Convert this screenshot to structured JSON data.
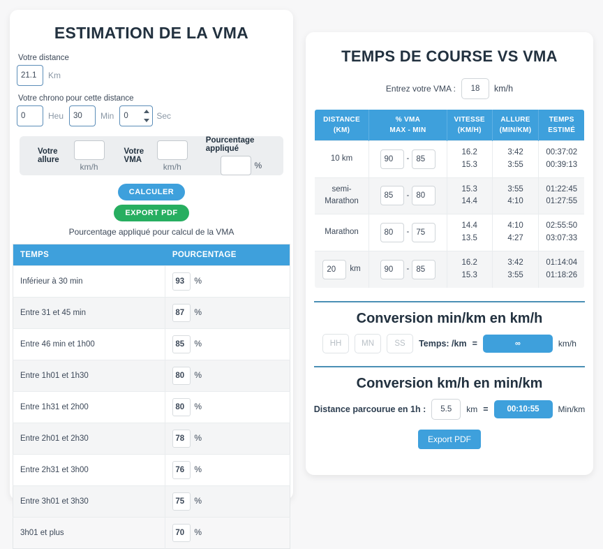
{
  "left_panel": {
    "title": "ESTIMATION DE LA VMA",
    "distance": {
      "label": "Votre distance",
      "value": "21.1",
      "unit": "Km"
    },
    "chrono": {
      "label": "Votre chrono pour cette distance",
      "hours_value": "0",
      "hours_unit": "Heu",
      "minutes_value": "30",
      "minutes_unit": "Min",
      "seconds_value": "0",
      "seconds_unit": "Sec"
    },
    "results": {
      "allure_label": "Votre allure",
      "allure_value": "",
      "allure_unit": "km/h",
      "vma_label": "Votre VMA",
      "vma_value": "",
      "vma_unit": "km/h",
      "pourcentage_label": "Pourcentage appliqué",
      "pourcentage_value": "",
      "pourcentage_unit": "%"
    },
    "buttons": {
      "calculer": "CALCULER",
      "export_pdf": "EXPORT PDF"
    },
    "table_caption": "Pourcentage appliqué pour calcul de la VMA",
    "table": {
      "headers": [
        "TEMPS",
        "POURCENTAGE"
      ],
      "rows": [
        {
          "temps": "Inférieur à 30 min",
          "pourcentage": "93",
          "unit": "%"
        },
        {
          "temps": "Entre 31 et 45 min",
          "pourcentage": "87",
          "unit": "%"
        },
        {
          "temps": "Entre 46 min et 1h00",
          "pourcentage": "85",
          "unit": "%"
        },
        {
          "temps": "Entre 1h01 et 1h30",
          "pourcentage": "80",
          "unit": "%"
        },
        {
          "temps": "Entre 1h31 et 2h00",
          "pourcentage": "80",
          "unit": "%"
        },
        {
          "temps": "Entre 2h01 et 2h30",
          "pourcentage": "78",
          "unit": "%"
        },
        {
          "temps": "Entre 2h31 et 3h00",
          "pourcentage": "76",
          "unit": "%"
        },
        {
          "temps": "Entre 3h01 et 3h30",
          "pourcentage": "75",
          "unit": "%"
        },
        {
          "temps": "3h01 et plus",
          "pourcentage": "70",
          "unit": "%"
        }
      ]
    }
  },
  "right_panel": {
    "title": "TEMPS DE COURSE VS VMA",
    "vma_entry": {
      "label": "Entrez votre VMA :",
      "value": "18",
      "unit": "km/h"
    },
    "table": {
      "headers": [
        {
          "line1": "DISTANCE",
          "line2": "(KM)"
        },
        {
          "line1": "% VMA",
          "line2": "MAX - MIN"
        },
        {
          "line1": "VITESSE",
          "line2": "(KM/H)"
        },
        {
          "line1": "ALLURE",
          "line2": "(MIN/KM)"
        },
        {
          "line1": "TEMPS",
          "line2": "ESTIMÉ"
        }
      ],
      "rows": [
        {
          "distance_label": "10 km",
          "distance_editable": false,
          "distance_value": "",
          "distance_unit": "",
          "vma_max": "90",
          "dash": "-",
          "vma_min": "85",
          "vitesse_max": "16.2",
          "vitesse_min": "15.3",
          "allure_max": "3:42",
          "allure_min": "3:55",
          "temps_max": "00:37:02",
          "temps_min": "00:39:13"
        },
        {
          "distance_label": "semi-\nMarathon",
          "distance_line1": "semi-",
          "distance_line2": "Marathon",
          "distance_editable": false,
          "distance_value": "",
          "distance_unit": "",
          "vma_max": "85",
          "dash": "-",
          "vma_min": "80",
          "vitesse_max": "15.3",
          "vitesse_min": "14.4",
          "allure_max": "3:55",
          "allure_min": "4:10",
          "temps_max": "01:22:45",
          "temps_min": "01:27:55"
        },
        {
          "distance_label": "Marathon",
          "distance_editable": false,
          "distance_value": "",
          "distance_unit": "",
          "vma_max": "80",
          "dash": "-",
          "vma_min": "75",
          "vitesse_max": "14.4",
          "vitesse_min": "13.5",
          "allure_max": "4:10",
          "allure_min": "4:27",
          "temps_max": "02:55:50",
          "temps_min": "03:07:33"
        },
        {
          "distance_label": "",
          "distance_editable": true,
          "distance_value": "20",
          "distance_unit": "km",
          "vma_max": "90",
          "dash": "-",
          "vma_min": "85",
          "vitesse_max": "16.2",
          "vitesse_min": "15.3",
          "allure_max": "3:42",
          "allure_min": "3:55",
          "temps_max": "01:14:04",
          "temps_min": "01:18:26"
        }
      ]
    },
    "conversion_min_km": {
      "title": "Conversion min/km en km/h",
      "hh_placeholder": "HH",
      "hh_value": "",
      "mn_placeholder": "MN",
      "mn_value": "",
      "ss_placeholder": "SS",
      "ss_value": "",
      "label": "Temps: /km",
      "equals": "=",
      "result": "∞",
      "unit": "km/h"
    },
    "conversion_km_h": {
      "title": "Conversion km/h en min/km",
      "label": "Distance parcourue en 1h :",
      "value": "5.5",
      "unit": "km",
      "equals": "=",
      "result": "00:10:55",
      "result_unit": "Min/km",
      "export_label": "Export PDF"
    }
  },
  "colors": {
    "accent_blue": "#3ea0dc",
    "green": "#27ae60",
    "red": "#e74c3c",
    "divider": "#4a8fb5"
  }
}
